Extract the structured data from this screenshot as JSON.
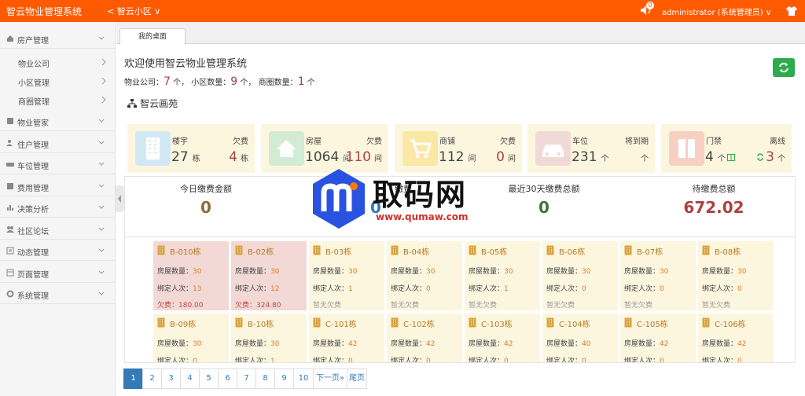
{
  "topbar": {
    "brand": "智云物业管理系统",
    "current_community": "智云小区",
    "notification_count": "0",
    "user": "administrator (系统管理员)"
  },
  "sidebar": {
    "groups": [
      {
        "label": "房产管理",
        "icon": "house-icon",
        "sub": [
          "物业公司",
          "小区管理",
          "商圈管理"
        ]
      },
      {
        "label": "物业管家",
        "icon": "butler-icon"
      },
      {
        "label": "住户管理",
        "icon": "users-icon"
      },
      {
        "label": "车位管理",
        "icon": "car-icon"
      },
      {
        "label": "费用管理",
        "icon": "money-icon"
      },
      {
        "label": "决策分析",
        "icon": "chart-icon"
      },
      {
        "label": "社区论坛",
        "icon": "forum-icon"
      },
      {
        "label": "动态管理",
        "icon": "news-icon"
      },
      {
        "label": "页面管理",
        "icon": "page-icon"
      },
      {
        "label": "系统管理",
        "icon": "gear-icon"
      }
    ]
  },
  "tabs": {
    "active": "我的桌面"
  },
  "main": {
    "welcome": "欢迎使用智云物业管理系统",
    "stats": {
      "company_label": "物业公司：",
      "company_count": "7",
      "company_unit": " 个，",
      "community_label": "小区数量：",
      "community_count": "9",
      "community_unit": " 个，",
      "district_label": "商圈数量：",
      "district_count": "1",
      "district_unit": " 个"
    },
    "community_name": "智云画苑"
  },
  "cards": [
    {
      "icon": "building-icon",
      "label": "楼宇",
      "value": "27",
      "unit": "栋",
      "right_label": "欠费",
      "right_value": "4",
      "right_unit": "栋"
    },
    {
      "icon": "home-icon",
      "label": "房屋",
      "value": "1064",
      "unit": "间",
      "right_label": "欠费",
      "right_value": "110",
      "right_unit": "间"
    },
    {
      "icon": "cart-icon",
      "label": "商铺",
      "value": "112",
      "unit": "间",
      "right_label": "欠费",
      "right_value": "0",
      "right_unit": "间"
    },
    {
      "icon": "car-icon",
      "label": "车位",
      "value": "231",
      "unit": "个",
      "right_label": "将到期",
      "right_value": "",
      "right_unit": "个"
    },
    {
      "icon": "door-icon",
      "label": "门禁",
      "value": "4",
      "unit": "个",
      "right_label": "离线",
      "right_value": "3",
      "right_unit": "个"
    }
  ],
  "fees": [
    {
      "label": "今日缴费金额",
      "value": "0",
      "color": "#8a6d3b"
    },
    {
      "label": "缴费",
      "value": "0",
      "color": "#337ab7"
    },
    {
      "label": "最近30天缴费总额",
      "value": "0",
      "color": "#3c763d"
    },
    {
      "label": "待缴费总额",
      "value": "672.02",
      "color": "#a94442"
    }
  ],
  "buildings_labels": {
    "rooms": "房屋数量：",
    "bound": "绑定人次：",
    "owe": "欠费：",
    "none": "暂无欠费"
  },
  "buildings": [
    {
      "name": "B-010栋",
      "rooms": "30",
      "bound": "13",
      "owe": "180.00"
    },
    {
      "name": "B-02栋",
      "rooms": "30",
      "bound": "12",
      "owe": "324.80"
    },
    {
      "name": "B-03栋",
      "rooms": "30",
      "bound": "1",
      "owe": ""
    },
    {
      "name": "B-04栋",
      "rooms": "30",
      "bound": "0",
      "owe": ""
    },
    {
      "name": "B-05栋",
      "rooms": "30",
      "bound": "1",
      "owe": ""
    },
    {
      "name": "B-06栋",
      "rooms": "30",
      "bound": "0",
      "owe": ""
    },
    {
      "name": "B-07栋",
      "rooms": "30",
      "bound": "0",
      "owe": ""
    },
    {
      "name": "B-08栋",
      "rooms": "30",
      "bound": "0",
      "owe": ""
    },
    {
      "name": "B-09栋",
      "rooms": "30",
      "bound": "0",
      "owe": ""
    },
    {
      "name": "B-10栋",
      "rooms": "30",
      "bound": "1",
      "owe": ""
    },
    {
      "name": "C-101栋",
      "rooms": "42",
      "bound": "0",
      "owe": ""
    },
    {
      "name": "C-102栋",
      "rooms": "42",
      "bound": "0",
      "owe": ""
    },
    {
      "name": "C-103栋",
      "rooms": "42",
      "bound": "0",
      "owe": ""
    },
    {
      "name": "C-104栋",
      "rooms": "40",
      "bound": "0",
      "owe": ""
    },
    {
      "name": "C-105栋",
      "rooms": "42",
      "bound": "0",
      "owe": ""
    },
    {
      "name": "C-106栋",
      "rooms": "42",
      "bound": "0",
      "owe": ""
    }
  ],
  "pagination": [
    "1",
    "2",
    "3",
    "4",
    "5",
    "6",
    "7",
    "8",
    "9",
    "10",
    "下一页»",
    "尾页"
  ],
  "watermark": {
    "text": "取码网",
    "url": "www.qumaw.com"
  },
  "colors": {
    "topbar": "#ff5a00",
    "accent": "#337ab7",
    "danger": "#a94442",
    "success": "#2eab4e"
  }
}
